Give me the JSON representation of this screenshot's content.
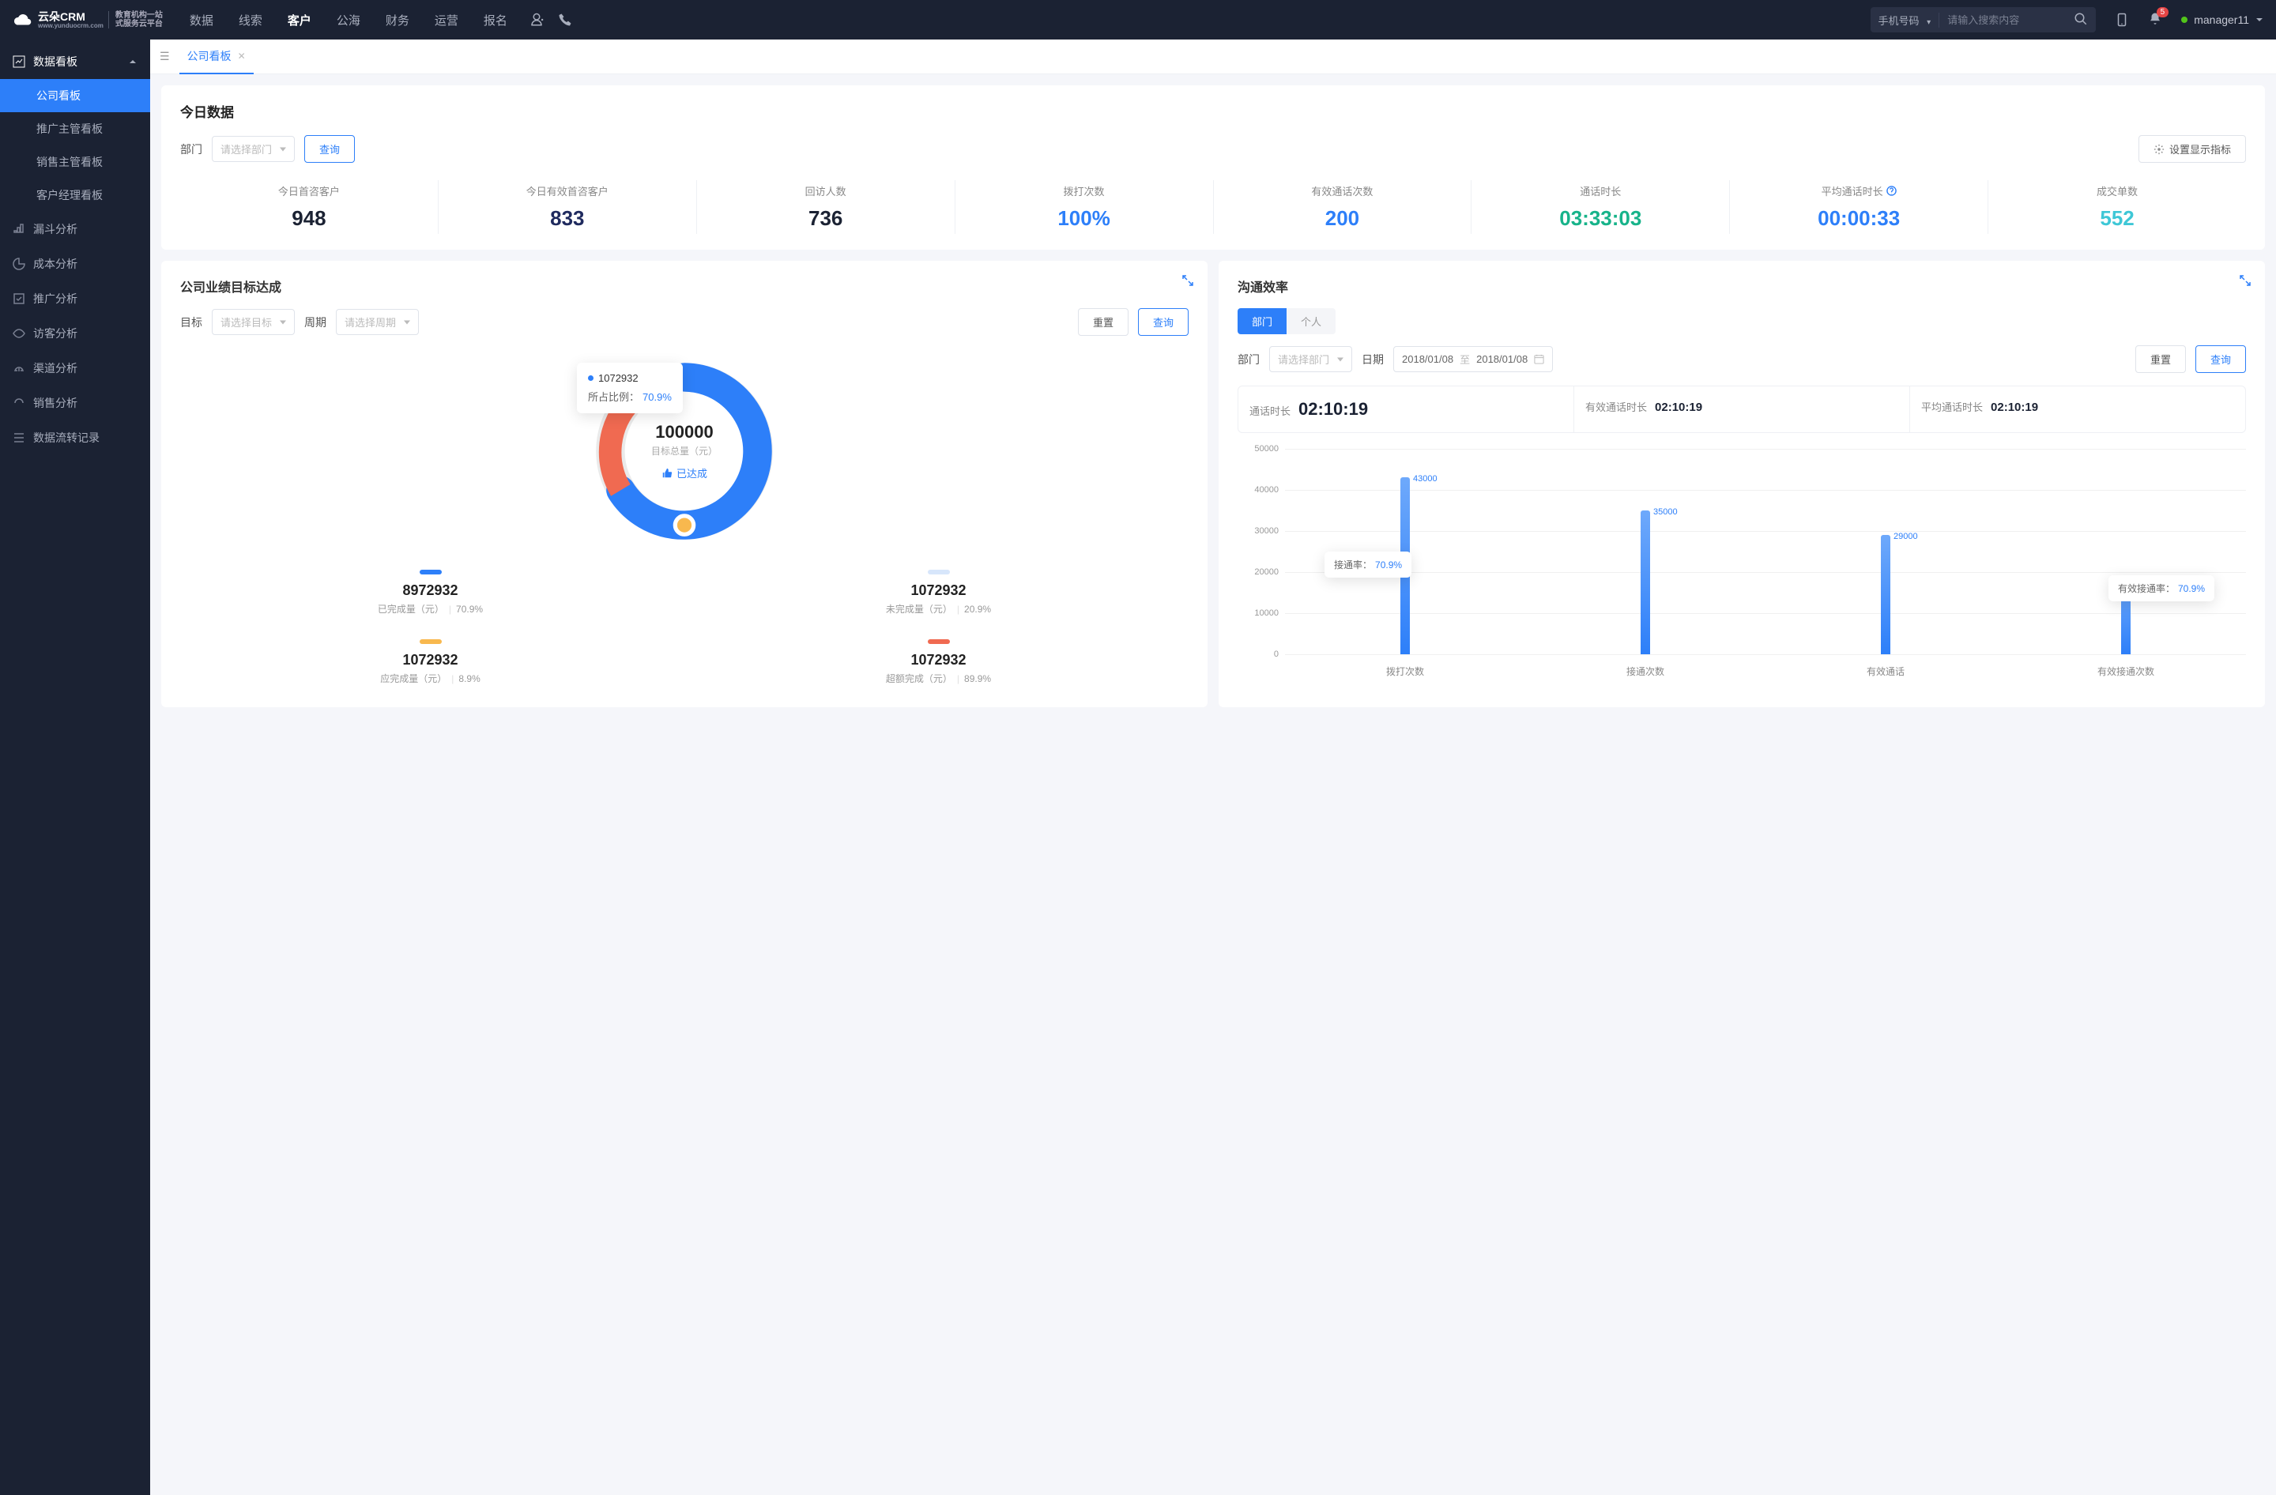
{
  "header": {
    "logo_main": "云朵CRM",
    "logo_url": "www.yunduocrm.com",
    "logo_sub1": "教育机构一站",
    "logo_sub2": "式服务云平台",
    "nav": [
      "数据",
      "线索",
      "客户",
      "公海",
      "财务",
      "运营",
      "报名"
    ],
    "nav_active_index": 2,
    "search_type": "手机号码",
    "search_placeholder": "请输入搜索内容",
    "badge_count": "5",
    "user_name": "manager11"
  },
  "sidebar": {
    "group_title": "数据看板",
    "subs": [
      "公司看板",
      "推广主管看板",
      "销售主管看板",
      "客户经理看板"
    ],
    "sub_active_index": 0,
    "items": [
      "漏斗分析",
      "成本分析",
      "推广分析",
      "访客分析",
      "渠道分析",
      "销售分析",
      "数据流转记录"
    ]
  },
  "tab": {
    "label": "公司看板"
  },
  "today": {
    "title": "今日数据",
    "dept_label": "部门",
    "dept_placeholder": "请选择部门",
    "query_btn": "查询",
    "settings_btn": "设置显示指标",
    "stats": [
      {
        "label": "今日首咨客户",
        "value": "948",
        "cls": "black"
      },
      {
        "label": "今日有效首咨客户",
        "value": "833",
        "cls": "navy"
      },
      {
        "label": "回访人数",
        "value": "736",
        "cls": "black"
      },
      {
        "label": "拨打次数",
        "value": "100%",
        "cls": "blue"
      },
      {
        "label": "有效通话次数",
        "value": "200",
        "cls": "blue"
      },
      {
        "label": "通话时长",
        "value": "03:33:03",
        "cls": "green"
      },
      {
        "label": "平均通话时长",
        "value": "00:00:33",
        "cls": "blue",
        "help": true
      },
      {
        "label": "成交单数",
        "value": "552",
        "cls": "cyan"
      }
    ]
  },
  "performance": {
    "title": "公司业绩目标达成",
    "target_label": "目标",
    "target_placeholder": "请选择目标",
    "period_label": "周期",
    "period_placeholder": "请选择周期",
    "reset_btn": "重置",
    "query_btn": "查询",
    "center_value": "100000",
    "center_sub": "目标总量（元）",
    "center_status": "已达成",
    "tooltip_value": "1072932",
    "tooltip_ratio_label": "所占比例：",
    "tooltip_ratio": "70.9%",
    "legends": [
      {
        "color": "#2d7ff9",
        "value": "8972932",
        "label": "已完成量（元）",
        "pct": "70.9%"
      },
      {
        "color": "#d7e6fb",
        "value": "1072932",
        "label": "未完成量（元）",
        "pct": "20.9%"
      },
      {
        "color": "#f8b84e",
        "value": "1072932",
        "label": "应完成量（元）",
        "pct": "8.9%"
      },
      {
        "color": "#f06a51",
        "value": "1072932",
        "label": "超额完成（元）",
        "pct": "89.9%"
      }
    ]
  },
  "communication": {
    "title": "沟通效率",
    "seg_dept": "部门",
    "seg_person": "个人",
    "dept_label": "部门",
    "dept_placeholder": "请选择部门",
    "date_label": "日期",
    "date_from": "2018/01/08",
    "date_to_word": "至",
    "date_to": "2018/01/08",
    "reset_btn": "重置",
    "query_btn": "查询",
    "kpis": [
      {
        "k": "通话时长",
        "v": "02:10:19",
        "big": true
      },
      {
        "k": "有效通话时长",
        "v": "02:10:19"
      },
      {
        "k": "平均通话时长",
        "v": "02:10:19"
      }
    ],
    "tooltip1_k": "接通率：",
    "tooltip1_v": "70.9%",
    "tooltip2_k": "有效接通率：",
    "tooltip2_v": "70.9%"
  },
  "chart_data": {
    "type": "bar",
    "title": "沟通效率",
    "categories": [
      "拨打次数",
      "接通次数",
      "有效通话",
      "有效接通次数"
    ],
    "values": [
      43000,
      35000,
      29000,
      18000
    ],
    "ylim": [
      0,
      50000
    ],
    "yticks": [
      0,
      10000,
      20000,
      30000,
      40000,
      50000
    ],
    "ylabel": "",
    "xlabel": ""
  }
}
